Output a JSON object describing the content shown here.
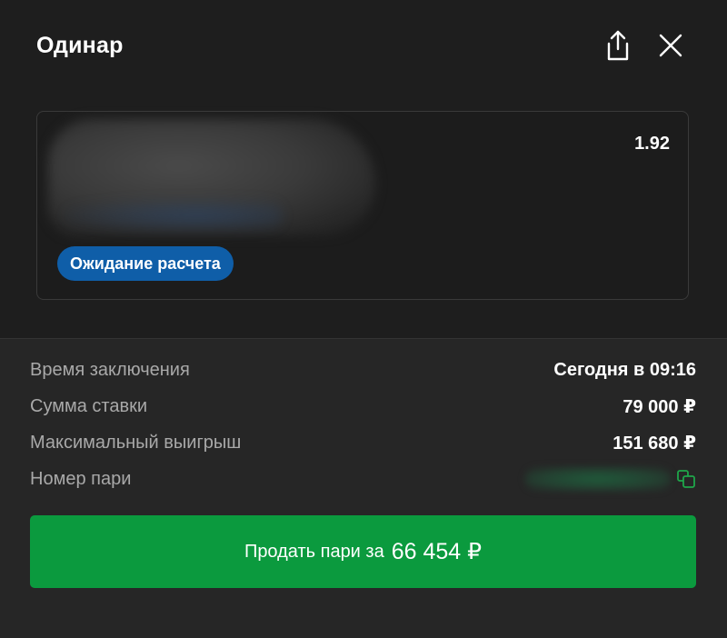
{
  "header": {
    "title": "Одинар",
    "share_icon": "share-icon",
    "close_icon": "close-icon"
  },
  "bet": {
    "odds": "1.92",
    "status": "Ожидание расчета",
    "status_color": "#0f5ea8"
  },
  "details": {
    "rows": [
      {
        "label": "Время заключения",
        "value": "Сегодня в 09:16"
      },
      {
        "label": "Сумма ставки",
        "value": "79 000 ₽"
      },
      {
        "label": "Максимальный выигрыш",
        "value": "151 680 ₽"
      },
      {
        "label": "Номер пари",
        "value": ""
      }
    ],
    "copy_icon": "copy-icon"
  },
  "action": {
    "sell_label": "Продать пари за",
    "sell_amount": "66 454 ₽",
    "button_color": "#0b9a3e"
  }
}
